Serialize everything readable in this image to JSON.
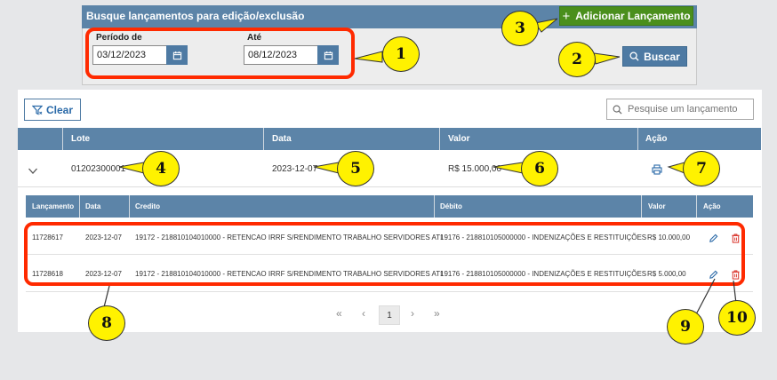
{
  "search_panel": {
    "title": "Busque lançamentos para edição/exclusão",
    "period_from_label": "Período de",
    "period_from_value": "03/12/2023",
    "period_to_label": "Até",
    "period_to_value": "08/12/2023",
    "add_button": "Adicionar Lançamento",
    "search_button": "Buscar"
  },
  "toolbar": {
    "clear_label": "Clear",
    "search_placeholder": "Pesquise um lançamento"
  },
  "lote_table": {
    "headers": {
      "lote": "Lote",
      "data": "Data",
      "valor": "Valor",
      "acao": "Ação"
    },
    "row": {
      "lote": "01202300001",
      "data": "2023-12-07",
      "valor": "R$ 15.000,00"
    }
  },
  "sub_table": {
    "headers": {
      "lancamento": "Lançamento",
      "data": "Data",
      "credito": "Credito",
      "debito": "Débito",
      "valor": "Valor",
      "acao": "Ação"
    },
    "rows": [
      {
        "lancamento": "11728617",
        "data": "2023-12-07",
        "credito": "19172 - 218810104010000 - RETENCAO IRRF S/RENDIMENTO TRABALHO SERVIDORES ATI",
        "debito": "19176 - 218810105000000 - INDENIZAÇÕES E RESTITUIÇÕES",
        "valor": "R$ 10.000,00"
      },
      {
        "lancamento": "11728618",
        "data": "2023-12-07",
        "credito": "19172 - 218810104010000 - RETENCAO IRRF S/RENDIMENTO TRABALHO SERVIDORES ATI",
        "debito": "19176 - 218810105000000 - INDENIZAÇÕES E RESTITUIÇÕES",
        "valor": "R$ 5.000,00"
      }
    ]
  },
  "pagination": {
    "first": "«",
    "prev": "‹",
    "current": "1",
    "next": "›",
    "last": "»"
  },
  "callouts": [
    "1",
    "2",
    "3",
    "4",
    "5",
    "6",
    "7",
    "8",
    "9",
    "10"
  ],
  "colors": {
    "header_blue": "#5c84a8",
    "add_green": "#4a8f1c",
    "annotation_red": "#ff2a00",
    "callout_yellow": "#fff200",
    "edit_blue": "#2b6aa8",
    "delete_red": "#d9342b"
  },
  "icons": {
    "calendar": "calendar-icon",
    "plus": "plus-icon",
    "search": "search-icon",
    "filter": "filter-icon",
    "chevron": "chevron-down-icon",
    "print": "print-icon",
    "edit": "pencil-icon",
    "delete": "trash-icon"
  }
}
